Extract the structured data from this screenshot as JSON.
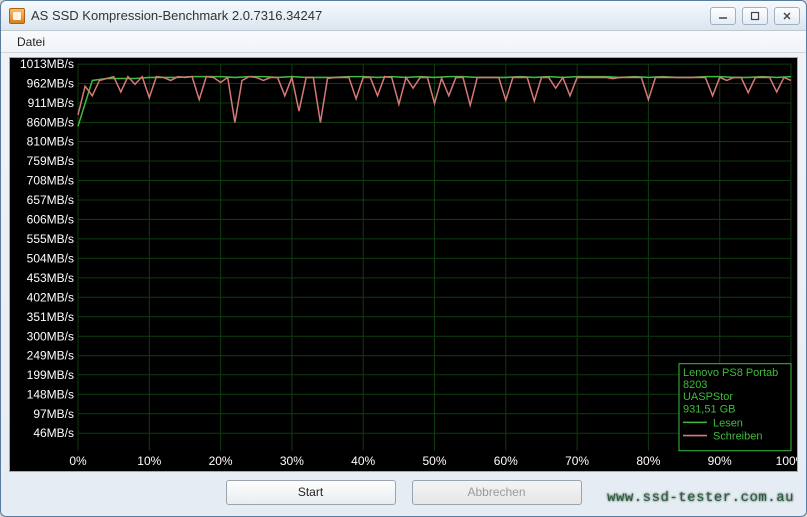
{
  "window": {
    "title": "AS SSD Kompression-Benchmark 2.0.7316.34247"
  },
  "menu": {
    "file": "Datei"
  },
  "buttons": {
    "start": "Start",
    "cancel": "Abbrechen"
  },
  "legend": {
    "device_line1": "Lenovo PS8 Portab",
    "device_line2": "8203",
    "driver": "UASPStor",
    "capacity": "931,51 GB",
    "read": "Lesen",
    "write": "Schreiben"
  },
  "watermark": "www.ssd-tester.com.au",
  "chart_data": {
    "type": "line",
    "title": "",
    "xlabel": "",
    "ylabel": "",
    "xlim": [
      0,
      100
    ],
    "ylim": [
      0,
      1013
    ],
    "y_ticks": [
      46,
      97,
      148,
      199,
      249,
      300,
      351,
      402,
      453,
      504,
      555,
      606,
      657,
      708,
      759,
      810,
      860,
      911,
      962,
      1013
    ],
    "y_tick_labels": [
      "46MB/s",
      "97MB/s",
      "148MB/s",
      "199MB/s",
      "249MB/s",
      "300MB/s",
      "351MB/s",
      "402MB/s",
      "453MB/s",
      "504MB/s",
      "555MB/s",
      "606MB/s",
      "657MB/s",
      "708MB/s",
      "759MB/s",
      "810MB/s",
      "860MB/s",
      "911MB/s",
      "962MB/s",
      "1013MB/s"
    ],
    "x_ticks": [
      0,
      10,
      20,
      30,
      40,
      50,
      60,
      70,
      80,
      90,
      100
    ],
    "x_tick_labels": [
      "0%",
      "10%",
      "20%",
      "30%",
      "40%",
      "50%",
      "60%",
      "70%",
      "80%",
      "90%",
      "100%"
    ],
    "series": [
      {
        "name": "Lesen",
        "color": "#3dbd3d",
        "x": [
          0,
          2,
          4,
          6,
          8,
          10,
          12,
          14,
          16,
          18,
          20,
          22,
          24,
          26,
          28,
          30,
          32,
          34,
          36,
          38,
          40,
          42,
          44,
          46,
          48,
          50,
          52,
          54,
          56,
          58,
          60,
          62,
          64,
          66,
          68,
          70,
          72,
          74,
          76,
          78,
          80,
          82,
          84,
          86,
          88,
          90,
          92,
          94,
          96,
          98,
          100
        ],
        "values": [
          850,
          970,
          975,
          975,
          975,
          978,
          978,
          978,
          980,
          980,
          980,
          978,
          980,
          980,
          978,
          980,
          978,
          978,
          978,
          980,
          980,
          978,
          980,
          978,
          980,
          978,
          980,
          980,
          978,
          978,
          978,
          980,
          978,
          980,
          978,
          980,
          980,
          980,
          978,
          980,
          978,
          980,
          978,
          978,
          980,
          980,
          978,
          978,
          980,
          978,
          980
        ]
      },
      {
        "name": "Schreiben",
        "color": "#d67878",
        "x": [
          0,
          1,
          2,
          3,
          4,
          5,
          6,
          7,
          8,
          9,
          10,
          11,
          12,
          13,
          14,
          15,
          16,
          17,
          18,
          19,
          20,
          21,
          22,
          23,
          24,
          25,
          26,
          27,
          28,
          29,
          30,
          31,
          32,
          33,
          34,
          35,
          36,
          37,
          38,
          39,
          40,
          41,
          42,
          43,
          44,
          45,
          46,
          47,
          48,
          49,
          50,
          51,
          52,
          53,
          54,
          55,
          56,
          57,
          58,
          59,
          60,
          61,
          62,
          63,
          64,
          65,
          66,
          67,
          68,
          69,
          70,
          71,
          72,
          73,
          74,
          75,
          76,
          77,
          78,
          79,
          80,
          81,
          82,
          83,
          84,
          85,
          86,
          87,
          88,
          89,
          90,
          91,
          92,
          93,
          94,
          95,
          96,
          97,
          98,
          99,
          100
        ],
        "values": [
          880,
          955,
          930,
          970,
          975,
          980,
          940,
          980,
          960,
          980,
          925,
          980,
          978,
          970,
          980,
          978,
          980,
          920,
          980,
          978,
          965,
          978,
          860,
          970,
          980,
          978,
          970,
          978,
          978,
          930,
          978,
          890,
          978,
          978,
          860,
          975,
          978,
          978,
          978,
          922,
          978,
          978,
          930,
          980,
          978,
          908,
          978,
          950,
          978,
          978,
          910,
          976,
          930,
          978,
          978,
          905,
          978,
          978,
          978,
          978,
          918,
          978,
          978,
          978,
          916,
          978,
          978,
          950,
          978,
          930,
          978,
          978,
          978,
          978,
          978,
          975,
          978,
          978,
          978,
          978,
          920,
          978,
          978,
          978,
          978,
          978,
          978,
          978,
          978,
          930,
          978,
          970,
          978,
          978,
          938,
          978,
          978,
          978,
          940,
          978,
          970
        ]
      }
    ]
  }
}
